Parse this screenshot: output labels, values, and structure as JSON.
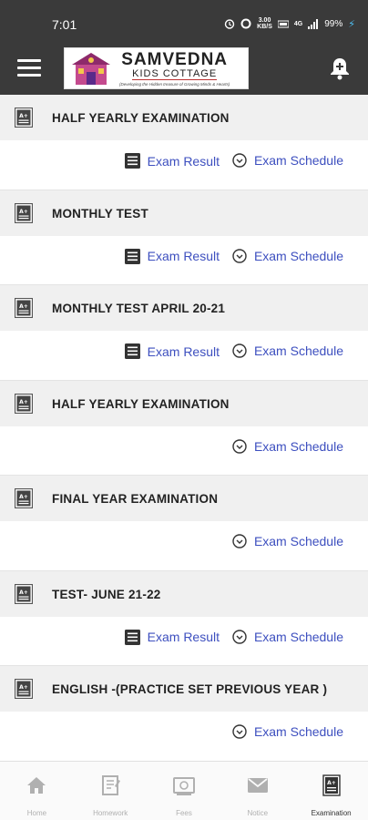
{
  "status_bar": {
    "time": "7:01",
    "net_speed_top": "3.00",
    "net_speed_bottom": "KB/S",
    "signal_label": "4G",
    "battery": "99%"
  },
  "app_bar": {
    "logo_title": "SAMVEDNA",
    "logo_subtitle": "KIDS COTTAGE",
    "logo_tagline": "(Developing the Hidden treasure of Growing Minds & Hearts)"
  },
  "exam_actions": {
    "result_label": "Exam Result",
    "schedule_label": "Exam Schedule"
  },
  "exams": [
    {
      "title": "HALF YEARLY EXAMINATION",
      "has_result": true
    },
    {
      "title": "MONTHLY TEST",
      "has_result": true
    },
    {
      "title": "MONTHLY TEST APRIL 20-21",
      "has_result": true
    },
    {
      "title": "HALF YEARLY EXAMINATION",
      "has_result": false
    },
    {
      "title": "FINAL YEAR EXAMINATION",
      "has_result": false
    },
    {
      "title": "TEST- JUNE 21-22",
      "has_result": true
    },
    {
      "title": "ENGLISH -(PRACTICE SET PREVIOUS YEAR )",
      "has_result": false
    }
  ],
  "bottom_nav": [
    {
      "label": "Home",
      "icon": "home-icon",
      "active": false
    },
    {
      "label": "Homework",
      "icon": "homework-icon",
      "active": false
    },
    {
      "label": "Fees",
      "icon": "fees-icon",
      "active": false
    },
    {
      "label": "Notice",
      "icon": "notice-icon",
      "active": false
    },
    {
      "label": "Examination",
      "icon": "examination-icon",
      "active": true
    }
  ],
  "colors": {
    "app_bar": "#3a3a3a",
    "link": "#3d4fbf",
    "card_header": "#f0f0f0"
  }
}
